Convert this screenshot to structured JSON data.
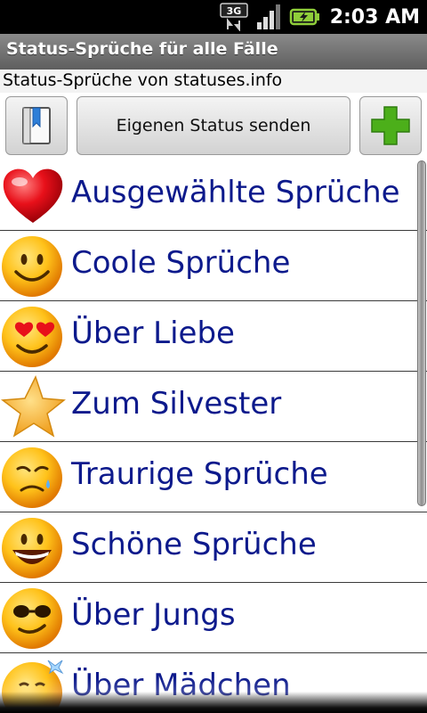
{
  "status_bar": {
    "network": "3G",
    "time": "2:03 AM"
  },
  "title_bar": {
    "title": "Status-Sprüche für alle Fälle"
  },
  "subtitle": "Status-Sprüche von statuses.info",
  "toolbar": {
    "bookmark_icon": "bookmark-icon",
    "send_button_label": "Eigenen Status senden",
    "add_icon": "plus-icon",
    "add_color": "#4caf1a"
  },
  "list": {
    "items": [
      {
        "label": "Ausgewählte Sprüche",
        "icon": "heart-icon"
      },
      {
        "label": "Coole Sprüche",
        "icon": "smiley-icon"
      },
      {
        "label": "Über Liebe",
        "icon": "heart-eyes-smiley-icon"
      },
      {
        "label": "Zum Silvester",
        "icon": "star-icon"
      },
      {
        "label": "Traurige Sprüche",
        "icon": "sad-smiley-icon"
      },
      {
        "label": "Schöne Sprüche",
        "icon": "laughing-smiley-icon"
      },
      {
        "label": "Über Jungs",
        "icon": "sunglasses-smiley-icon"
      },
      {
        "label": "Über Mädchen",
        "icon": "girl-smiley-icon"
      }
    ],
    "label_color": "#0d1a8c"
  }
}
